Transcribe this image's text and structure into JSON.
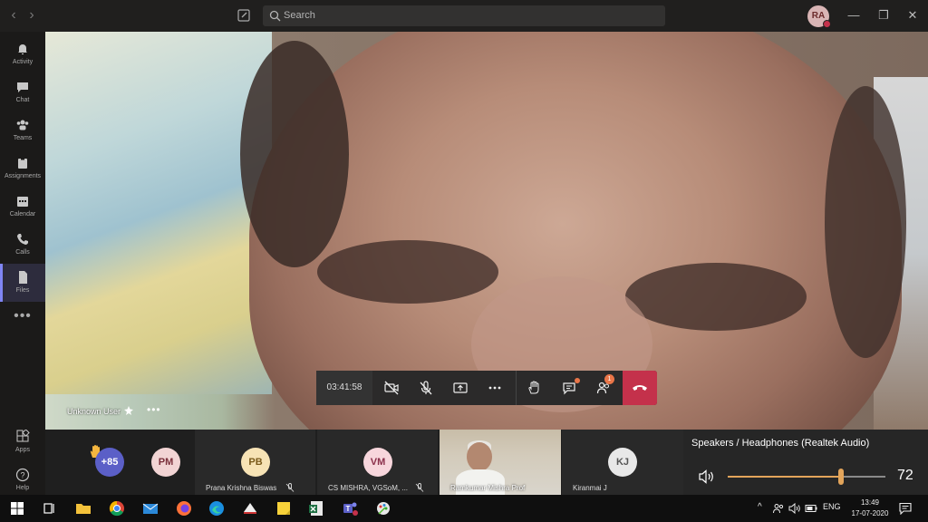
{
  "titlebar": {
    "search_placeholder": "Search",
    "user_initials": "RA"
  },
  "rail": {
    "items": [
      {
        "label": "Activity"
      },
      {
        "label": "Chat"
      },
      {
        "label": "Teams"
      },
      {
        "label": "Assignments"
      },
      {
        "label": "Calendar"
      },
      {
        "label": "Calls"
      },
      {
        "label": "Files"
      }
    ],
    "more": "•••",
    "apps_label": "Apps",
    "help_label": "Help"
  },
  "stage": {
    "speaker_name": "Unknown User",
    "more": "•••"
  },
  "controls": {
    "timer": "03:41:58",
    "participants_badge": "1"
  },
  "strip": {
    "overflow": "+85",
    "tiles": [
      {
        "initials": "PM",
        "name": "",
        "color": "#f2d4d4",
        "text_color": "#7a2f3a"
      },
      {
        "initials": "PB",
        "name": "Prana Krishna Biswas",
        "color": "#f7e3b5",
        "text_color": "#7a5a1a"
      },
      {
        "initials": "VM",
        "name": "CS MISHRA, VGSoM, ...",
        "color": "#f7d6dc",
        "text_color": "#8a2f4a"
      },
      {
        "initials": "",
        "name": "Ramkumar Mishra Prof",
        "color": "",
        "text_color": ""
      },
      {
        "initials": "KJ",
        "name": "Kiranmai J",
        "color": "#e8e8e8",
        "text_color": "#555555"
      }
    ]
  },
  "volume": {
    "device": "Speakers / Headphones (Realtek Audio)",
    "level": 72
  },
  "taskbar": {
    "language": "ENG",
    "time": "13:49",
    "date": "17-07-2020"
  },
  "colors": {
    "hangup": "#c4314b",
    "accent": "#7f85f5",
    "volume_fill": "#e2a45a",
    "overflow_avatar": "#5b5fc7"
  }
}
